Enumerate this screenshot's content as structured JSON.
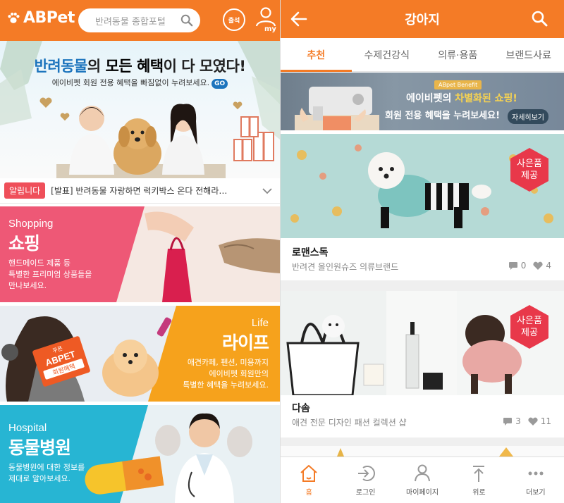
{
  "left": {
    "logo": "ABPet",
    "search_placeholder": "반려동물 종합포털",
    "attend_label": "출석",
    "my_label": "my",
    "hero": {
      "title_part1": "반려동물",
      "title_part2": "의 ",
      "title_part3": "모든 혜택",
      "title_part4": "이 다 모였다!",
      "subtitle": "에이비펫 회원 전용 혜택을 빠짐없이 누려보세요.",
      "go_label": "GO"
    },
    "notice": {
      "tag": "알립니다",
      "text": "[발표] 반려동물 자랑하면 럭키박스 온다 전해라…"
    },
    "categories": {
      "shopping": {
        "en": "Shopping",
        "ko": "쇼핑",
        "desc_line1": "핸드메이드 제품 등",
        "desc_line2": "특별한 프리미엄 상품들을",
        "desc_line3": "만나보세요.",
        "color": "#ee5876"
      },
      "life": {
        "en": "Life",
        "ko": "라이프",
        "desc_line1": "애견카페, 펜션, 미용까지",
        "desc_line2": "에이비펫 회원만의",
        "desc_line3": "특별한 혜택을 누려보세요.",
        "coupon_top": "쿠폰",
        "coupon_brand": "ABPET",
        "coupon_sub": "회원혜택",
        "color": "#f6a21c"
      },
      "hospital": {
        "en": "Hospital",
        "ko": "동물병원",
        "desc_line1": "동물병원에 대한 정보를",
        "desc_line2": "제대로 알아보세요.",
        "color": "#27b5d3"
      }
    }
  },
  "right": {
    "title": "강아지",
    "tabs": [
      "추천",
      "수제건강식",
      "의류·용품",
      "브랜드사료"
    ],
    "active_tab": 0,
    "promo": {
      "tag": "ABpet Benefit",
      "line1_part1": "에이비펫의 ",
      "line1_part2": "차별화된 쇼핑!",
      "line2": "회원 전용 혜택을 누려보세요!",
      "button": "자세히보기"
    },
    "badge_line1": "사은품",
    "badge_line2": "제공",
    "products": [
      {
        "name": "로맨스독",
        "desc": "반려견 올인원슈즈 의류브랜드",
        "comments": "0",
        "likes": "4"
      },
      {
        "name": "다솜",
        "desc": "애견 전문 디자인 패션 컬렉션 샵",
        "comments": "3",
        "likes": "11"
      }
    ],
    "nav": [
      {
        "label": "홈",
        "icon": "home-icon"
      },
      {
        "label": "로그인",
        "icon": "login-icon"
      },
      {
        "label": "마이페이지",
        "icon": "my-page-icon"
      },
      {
        "label": "위로",
        "icon": "arrow-up-icon"
      },
      {
        "label": "더보기",
        "icon": "more-icon"
      }
    ]
  },
  "colors": {
    "brand_orange": "#f47b26",
    "notice_red": "#ef4f5a",
    "link_blue": "#1c74bd"
  }
}
